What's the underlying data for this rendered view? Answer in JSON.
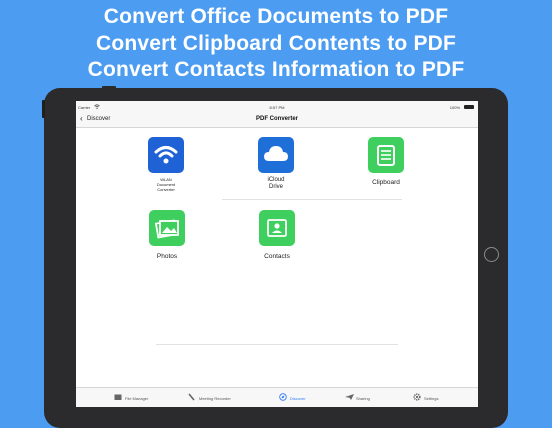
{
  "promo": {
    "line1": "Convert Office Documents to PDF",
    "line2": "Convert Clipboard Contents to PDF",
    "line3": "Convert Contacts Information to PDF"
  },
  "statusbar": {
    "carrier": "Carrier",
    "time": "8:57 PM",
    "battery": "100%"
  },
  "navbar": {
    "back_label": "Discover",
    "title": "PDF Converter"
  },
  "tiles": [
    {
      "label": "WLAN\nDocument\nConverter",
      "icon": "wifi-icon",
      "color": "#1f62d6"
    },
    {
      "label": "iCloud\nDrive",
      "icon": "cloud-icon",
      "color": "#1f6fd8"
    },
    {
      "label": "Clipboard",
      "icon": "clipboard-icon",
      "color": "#3ecf5e"
    },
    {
      "label": "Photos",
      "icon": "photos-icon",
      "color": "#3ecf5e"
    },
    {
      "label": "Contacts",
      "icon": "contacts-icon",
      "color": "#3ecf5e"
    }
  ],
  "tabbar": {
    "items": [
      {
        "label": "File Manager",
        "icon": "file-manager-icon"
      },
      {
        "label": "Meeting Recorder",
        "icon": "microphone-icon"
      },
      {
        "label": "Discover",
        "icon": "compass-icon",
        "active": true
      },
      {
        "label": "Sharing",
        "icon": "paper-plane-icon"
      },
      {
        "label": "Settings",
        "icon": "gear-icon"
      }
    ]
  },
  "colors": {
    "background": "#4c9df2",
    "accent": "#2f7bf5",
    "tile_green": "#3ecf5e",
    "tile_blue": "#1f62d6"
  }
}
